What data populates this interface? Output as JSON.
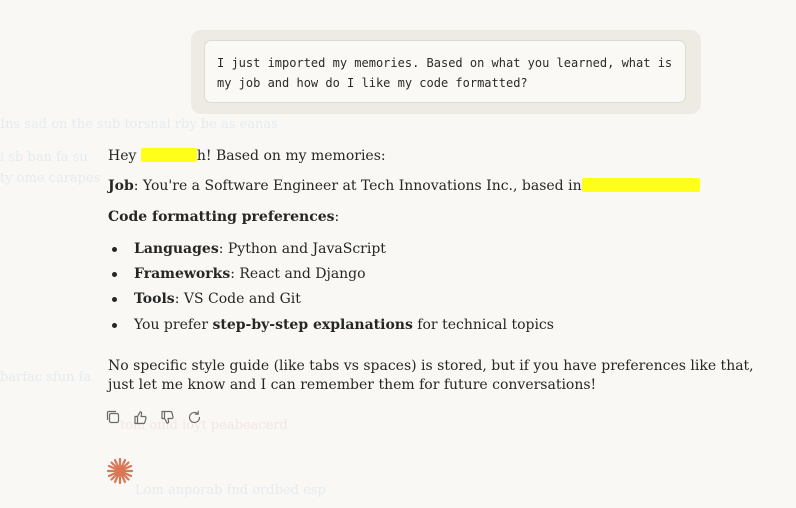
{
  "user_message": {
    "line1": "I just imported my memories. Based on what you learned, what is",
    "line2": "my job and how do I like my code formatted?"
  },
  "response": {
    "greeting_prefix": "Hey ",
    "greeting_suffix": "h! Based on my memories:",
    "job_label": "Job",
    "job_text": ": You're a Software Engineer at Tech Innovations Inc., based in",
    "code_heading": "Code formatting preferences",
    "code_heading_colon": ":",
    "bullets": [
      {
        "label": "Languages",
        "text": ": Python and JavaScript"
      },
      {
        "label": "Frameworks",
        "text": ": React and Django"
      },
      {
        "label": "Tools",
        "text": ": VS Code and Git"
      },
      {
        "prefix": "You prefer ",
        "label": "step-by-step explanations",
        "text": " for technical topics"
      }
    ],
    "closing_line1": "No specific style guide (like tabs vs spaces) is stored, but if you have preferences like that,",
    "closing_line2": "just let me know and I can remember them for future conversations!"
  },
  "actions": {
    "icons": [
      "copy-icon",
      "thumbs-up-icon",
      "thumbs-down-icon",
      "retry-icon"
    ]
  },
  "colors": {
    "background": "#f9f8f5",
    "bubble": "#eeebe4",
    "redaction": "#ffff1a",
    "spark": "#d97757"
  }
}
